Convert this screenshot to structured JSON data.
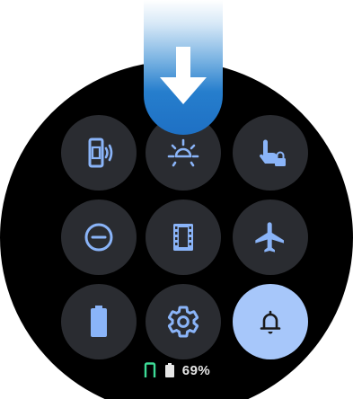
{
  "quick_settings": {
    "tiles": [
      {
        "icon": "phone-vibrate-icon",
        "state": "off"
      },
      {
        "icon": "brightness-icon",
        "state": "off"
      },
      {
        "icon": "touch-lock-icon",
        "state": "off"
      },
      {
        "icon": "do-not-disturb-icon",
        "state": "off"
      },
      {
        "icon": "theater-mode-icon",
        "state": "off"
      },
      {
        "icon": "airplane-icon",
        "state": "off"
      },
      {
        "icon": "battery-saver-icon",
        "state": "off"
      },
      {
        "icon": "settings-gear-icon",
        "state": "off"
      },
      {
        "icon": "bell-icon",
        "state": "on"
      }
    ],
    "icon_color": "#8ab4f8",
    "tile_color": "#2a2c31",
    "active_tile_color": "#a7c7fa",
    "active_icon_color": "#1a1a1a"
  },
  "swipe_hint": {
    "icon": "arrow-down-icon",
    "color": "#1e70c4"
  },
  "status": {
    "connection_icon": "phone-connected-icon",
    "battery_icon": "battery-icon",
    "battery_text": "69%"
  }
}
